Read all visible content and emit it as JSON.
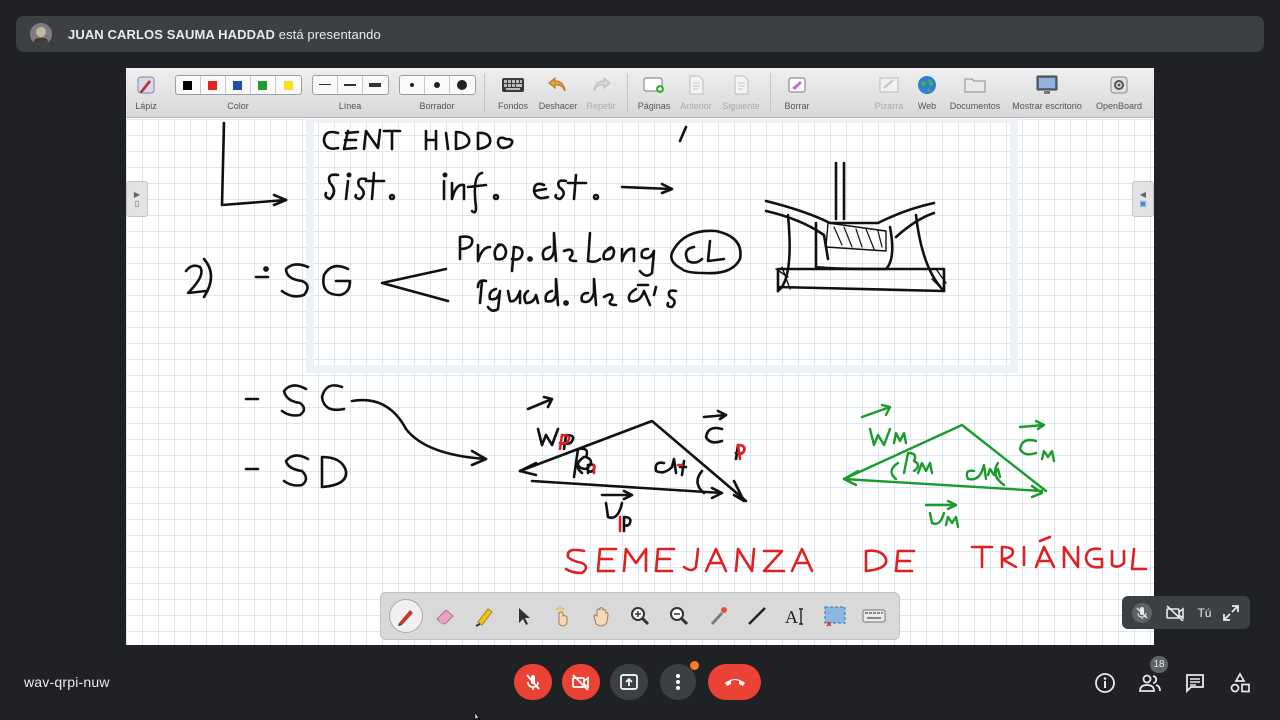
{
  "banner": {
    "presenter_name": "JUAN CARLOS SAUMA HADDAD",
    "presenting_text": " está presentando"
  },
  "openboard": {
    "toolbar": [
      {
        "key": "lapiz",
        "label": "Lápiz",
        "icon": "pencil-tool-icon"
      },
      {
        "key": "color",
        "label": "Color",
        "colors": [
          "#000000",
          "#e52222",
          "#1f4ea8",
          "#1f9e2b",
          "#f6e11c"
        ]
      },
      {
        "key": "linea",
        "label": "Línea"
      },
      {
        "key": "borrador",
        "label": "Borrador"
      },
      {
        "key": "fondos",
        "label": "Fondos",
        "icon": "keyboard-icon"
      },
      {
        "key": "deshacer",
        "label": "Deshacer",
        "icon": "undo-icon"
      },
      {
        "key": "repetir",
        "label": "Repetir",
        "icon": "redo-icon",
        "disabled": true
      },
      {
        "key": "paginas",
        "label": "Páginas",
        "icon": "add-page-icon"
      },
      {
        "key": "anterior",
        "label": "Anterior",
        "icon": "previous-page-icon",
        "disabled": true
      },
      {
        "key": "siguiente",
        "label": "Siguiente",
        "icon": "next-page-icon",
        "disabled": true
      },
      {
        "key": "borrar",
        "label": "Borrar",
        "icon": "clear-page-icon"
      },
      {
        "key": "pizarra",
        "label": "Pizarra",
        "icon": "board-icon",
        "disabled": true
      },
      {
        "key": "web",
        "label": "Web",
        "icon": "globe-icon"
      },
      {
        "key": "documentos",
        "label": "Documentos",
        "icon": "folder-icon"
      },
      {
        "key": "mostrar",
        "label": "Mostrar escritorio",
        "icon": "desktop-icon"
      },
      {
        "key": "openboard",
        "label": "OpenBoard",
        "icon": "settings-icon"
      }
    ],
    "floating_tools": [
      "pen-icon",
      "eraser-icon",
      "highlighter-icon",
      "selector-icon",
      "interact-icon",
      "hand-icon",
      "zoom-in-icon",
      "zoom-out-icon",
      "laser-pointer-icon",
      "line-icon",
      "text-icon",
      "capture-icon",
      "virtual-keyboard-icon"
    ],
    "ink_color_black": "#111111",
    "ink_color_red": "#e02020",
    "ink_color_green": "#1a9a2a"
  },
  "selfview": {
    "label": "Tú"
  },
  "bottom_bar": {
    "meeting_code": "wav-qrpi-nuw",
    "participant_count": "18",
    "accent_red": "#ea4335"
  }
}
